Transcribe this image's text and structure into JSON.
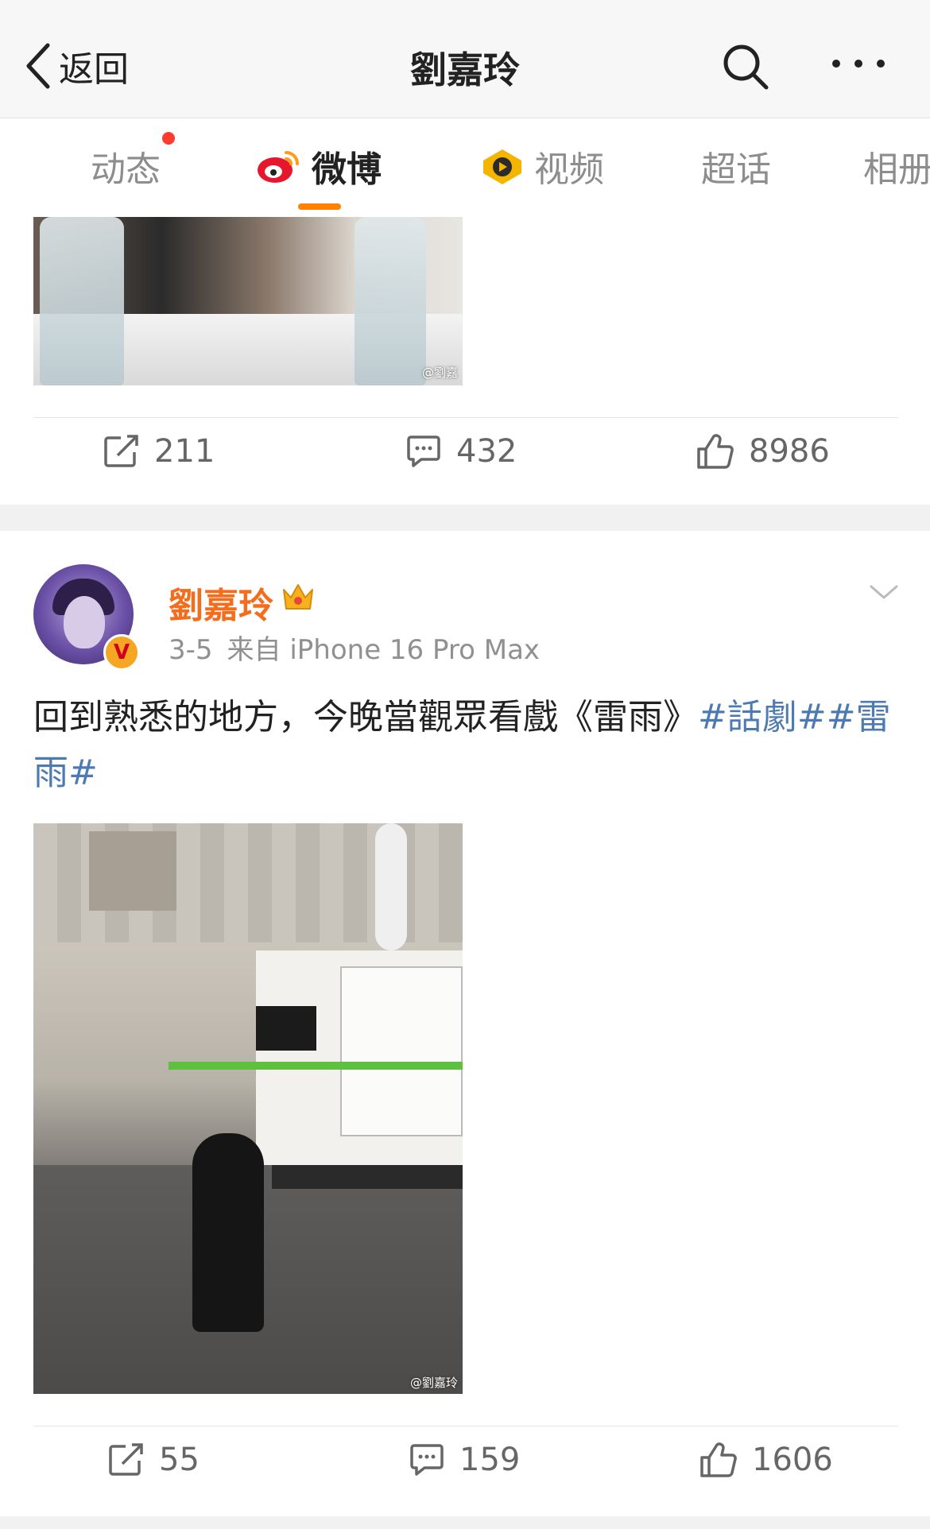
{
  "nav": {
    "back_label": "返回",
    "title": "劉嘉玲"
  },
  "tabs": [
    {
      "label": "动态",
      "has_red_dot": true
    },
    {
      "label": "微博",
      "active": true,
      "icon": "weibo-logo-icon"
    },
    {
      "label": "视频",
      "icon": "video-channel-icon"
    },
    {
      "label": "超话"
    },
    {
      "label": "相册"
    }
  ],
  "colors": {
    "accent": "#ff8200",
    "author_name": "#f56c1d",
    "hashtag": "#4d7bb1",
    "red_dot": "#ff3b30"
  },
  "post1": {
    "image_watermark": "@劉嘉",
    "actions": {
      "repost": "211",
      "comment": "432",
      "like": "8986"
    }
  },
  "post2": {
    "author": "劉嘉玲",
    "badge": "V",
    "date": "3-5",
    "source": "来自 iPhone 16 Pro Max",
    "text_plain": "回到熟悉的地方，今晚當觀眾看戲《雷雨》",
    "hashtag1": "#話劇#",
    "hashtag2": "#雷雨#",
    "image_watermark": "@劉嘉玲",
    "actions": {
      "repost": "55",
      "comment": "159",
      "like": "1606"
    }
  }
}
